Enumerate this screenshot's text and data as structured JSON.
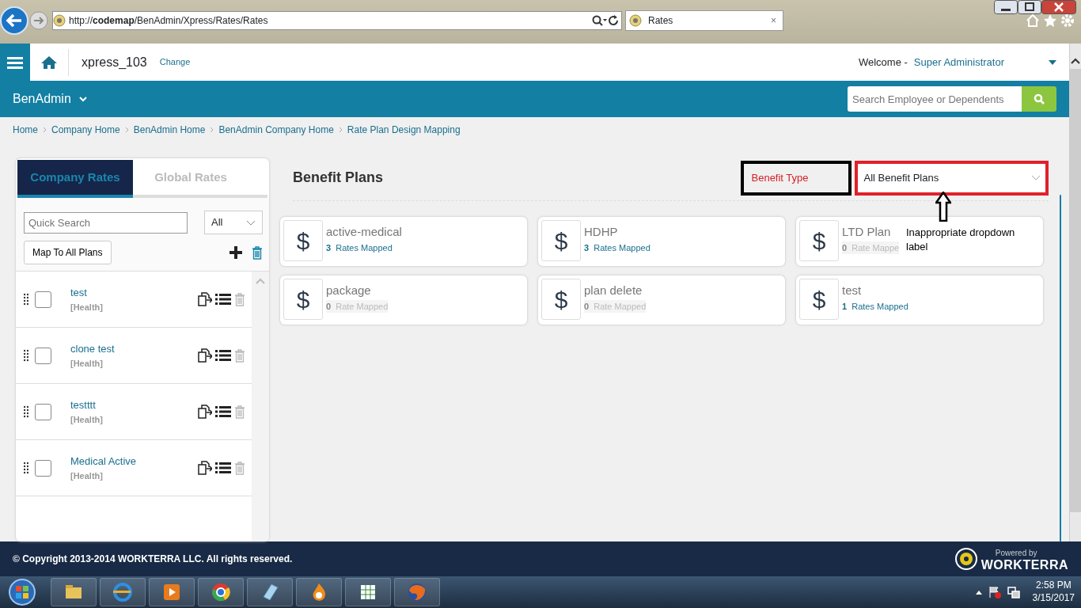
{
  "browser": {
    "url_prefix": "http://",
    "url_host": "codemap",
    "url_path": "/BenAdmin/Xpress/Rates/Rates",
    "tab": {
      "title": "Rates",
      "close": "×"
    }
  },
  "header": {
    "company": "xpress_103",
    "change": "Change",
    "welcome": "Welcome -",
    "user": "Super Administrator"
  },
  "module": {
    "title": "BenAdmin",
    "search": {
      "placeholder": "Search Employee or Dependents"
    }
  },
  "breadcrumbs": [
    "Home",
    "Company Home",
    "BenAdmin Home",
    "BenAdmin Company Home",
    "Rate Plan Design Mapping"
  ],
  "rates_panel": {
    "tabs": [
      {
        "label": "Company Rates",
        "selected": true
      },
      {
        "label": "Global Rates",
        "selected": false
      }
    ],
    "quick_search": {
      "placeholder": "Quick Search"
    },
    "filter": "All",
    "map_button": "Map To All Plans",
    "items": [
      {
        "name": "test",
        "category": "[Health]",
        "checked": false
      },
      {
        "name": "clone test",
        "category": "[Health]",
        "checked": false
      },
      {
        "name": "testttt",
        "category": "[Health]",
        "checked": false
      },
      {
        "name": "Medical Active",
        "category": "[Health]",
        "checked": false
      }
    ]
  },
  "plans_panel": {
    "title": "Benefit Plans",
    "filter_label": "Benefit Type",
    "filter_value": "All Benefit Plans",
    "plans": [
      {
        "symbol": "$",
        "name": "active-medical",
        "count": "3",
        "label": "Rates Mapped",
        "mapped": true
      },
      {
        "symbol": "$",
        "name": "HDHP",
        "count": "3",
        "label": "Rates Mapped",
        "mapped": true
      },
      {
        "symbol": "$",
        "name": "LTD Plan",
        "count": "0",
        "label": "Rate Mappe",
        "mapped": false
      },
      {
        "symbol": "$",
        "name": "package",
        "count": "0",
        "label": "Rate Mapped",
        "mapped": false
      },
      {
        "symbol": "$",
        "name": "plan delete",
        "count": "0",
        "label": "Rate Mapped",
        "mapped": false
      },
      {
        "symbol": "$",
        "name": "test",
        "count": "1",
        "label": "Rates Mapped",
        "mapped": true
      }
    ]
  },
  "annotation": {
    "note": "Inappropriate dropdown label"
  },
  "footer": {
    "copyright": "© Copyright 2013-2014 WORKTERRA LLC. All rights reserved.",
    "powered_by": "Powered by",
    "brand": "WORKTERRA"
  },
  "taskbar": {
    "time": "2:58 PM",
    "date": "3/15/2017"
  }
}
